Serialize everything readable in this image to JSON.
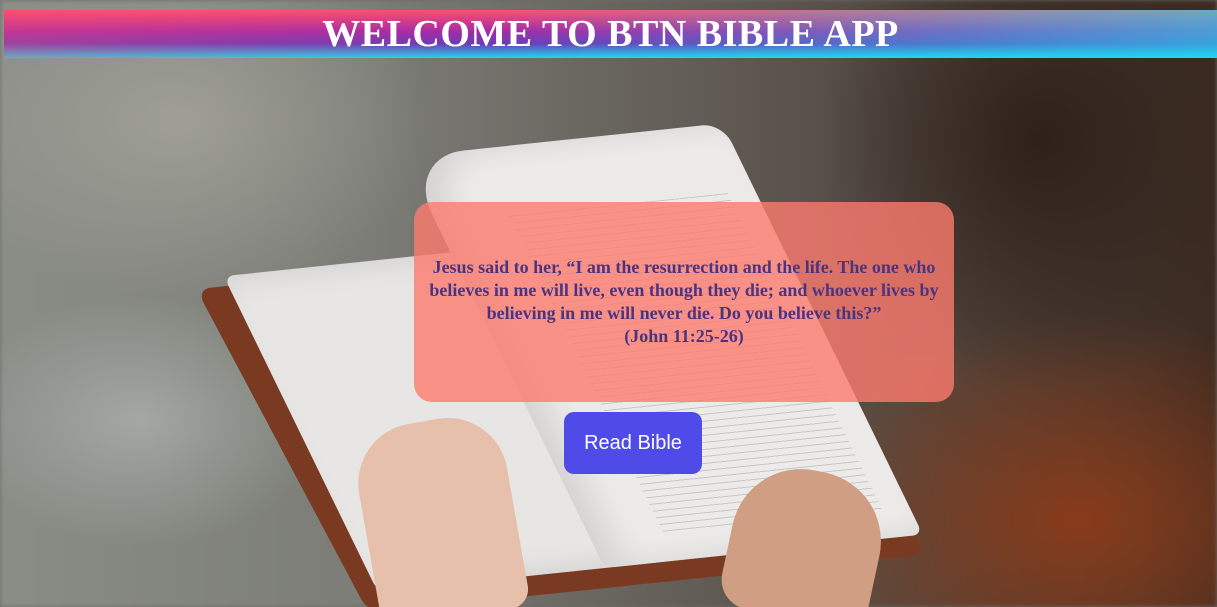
{
  "header": {
    "title": "WELCOME TO BTN BIBLE APP"
  },
  "verse": {
    "text": "Jesus said to her, “I am the resurrection and the life. The one who believes in me will live, even though they die; and whoever lives by believing in me will never die. Do you believe this?”",
    "reference": "(John 11:25-26)"
  },
  "actions": {
    "read_label": "Read Bible"
  },
  "colors": {
    "card": "#fc7b6e",
    "button": "#4e4be8",
    "verse_text": "#4a3480"
  }
}
